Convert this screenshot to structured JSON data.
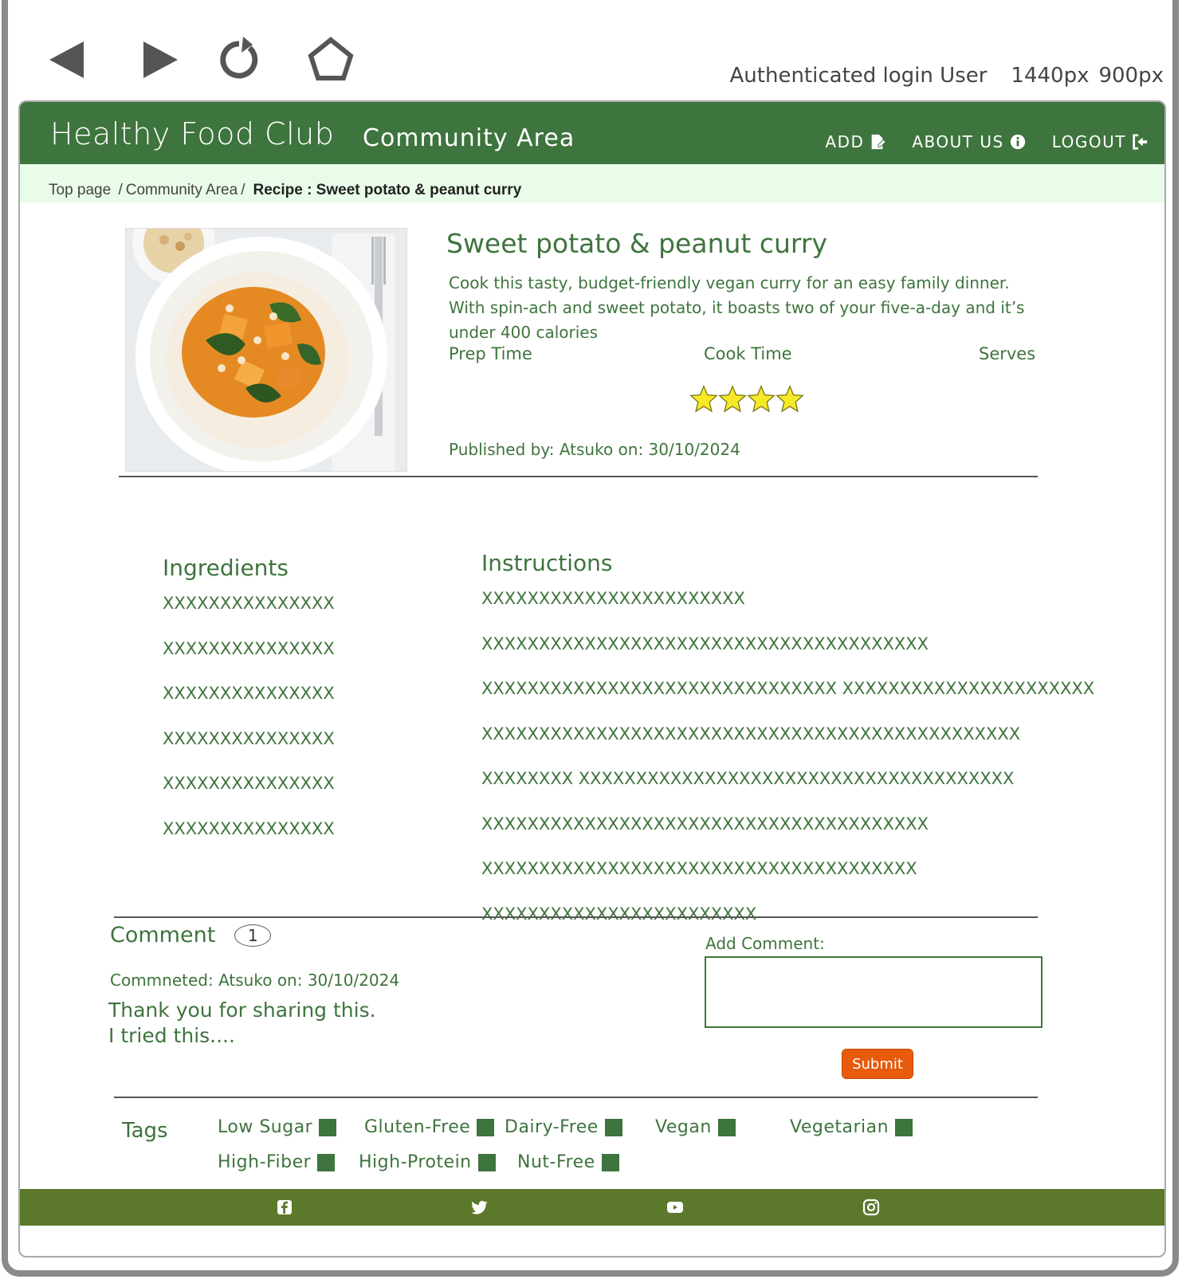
{
  "browser": {
    "viewport_label": "Authenticated login User",
    "width_label": "1440px",
    "height_label": "900px"
  },
  "nav": {
    "brand": "Healthy Food Club",
    "area": "Community Area",
    "links": [
      "ADD",
      "ABOUT US",
      "LOGOUT"
    ]
  },
  "breadcrumb": {
    "items": [
      "Top page",
      "Community Area"
    ],
    "current": "Recipe : Sweet potato & peanut curry"
  },
  "recipe": {
    "title": "Sweet potato & peanut curry",
    "description": "Cook this tasty, budget-friendly vegan curry for an easy family dinner. With spin-ach and sweet potato, it boasts two of your five-a-day and it’s under 400 calories",
    "prep_label": "Prep Time",
    "cook_label": "Cook Time",
    "serves_label": "Serves",
    "rating": 4,
    "published": "Published by: Atsuko  on: 30/10/2024"
  },
  "ingredients": {
    "heading": "Ingredients",
    "items": [
      "XXXXXXXXXXXXXXX",
      "XXXXXXXXXXXXXXX",
      "XXXXXXXXXXXXXXX",
      "XXXXXXXXXXXXXXX",
      "XXXXXXXXXXXXXXX",
      "XXXXXXXXXXXXXXX"
    ]
  },
  "instructions": {
    "heading": "Instructions",
    "items": [
      "XXXXXXXXXXXXXXXXXXXXXXX",
      "XXXXXXXXXXXXXXXXXXXXXXXXXXXXXXXXXXXXXXX",
      "XXXXXXXXXXXXXXXXXXXXXXXXXXXXXXX XXXXXXXXXXXXXXXXXXXXXX",
      "XXXXXXXXXXXXXXXXXXXXXXXXXXXXXXXXXXXXXXXXXXXXXXX",
      "XXXXXXXX XXXXXXXXXXXXXXXXXXXXXXXXXXXXXXXXXXXXXX",
      "XXXXXXXXXXXXXXXXXXXXXXXXXXXXXXXXXXXXXXX",
      "XXXXXXXXXXXXXXXXXXXXXXXXXXXXXXXXXXXXXX",
      "XXXXXXXXXXXXXXXXXXXXXXXX"
    ]
  },
  "comments": {
    "heading": "Comment",
    "count": "1",
    "meta": "Commneted: Atsuko  on: 30/10/2024",
    "body": "Thank you for sharing this.\nI tried this....",
    "add_label": "Add Comment:",
    "submit_label": "Submit"
  },
  "tags": {
    "label": "Tags",
    "items": [
      "Low Sugar",
      "Gluten-Free",
      "Dairy-Free",
      "Vegan",
      "Vegetarian",
      "High-Fiber",
      "High-Protein",
      "Nut-Free"
    ]
  },
  "footer": {
    "icons": [
      "facebook-icon",
      "twitter-icon",
      "youtube-icon",
      "instagram-icon"
    ]
  },
  "colors": {
    "primary_green": "#3e743d",
    "footer_green": "#5c782b",
    "breadcrumb_bg": "#e9fbe9",
    "submit_orange": "#e85a0c"
  }
}
